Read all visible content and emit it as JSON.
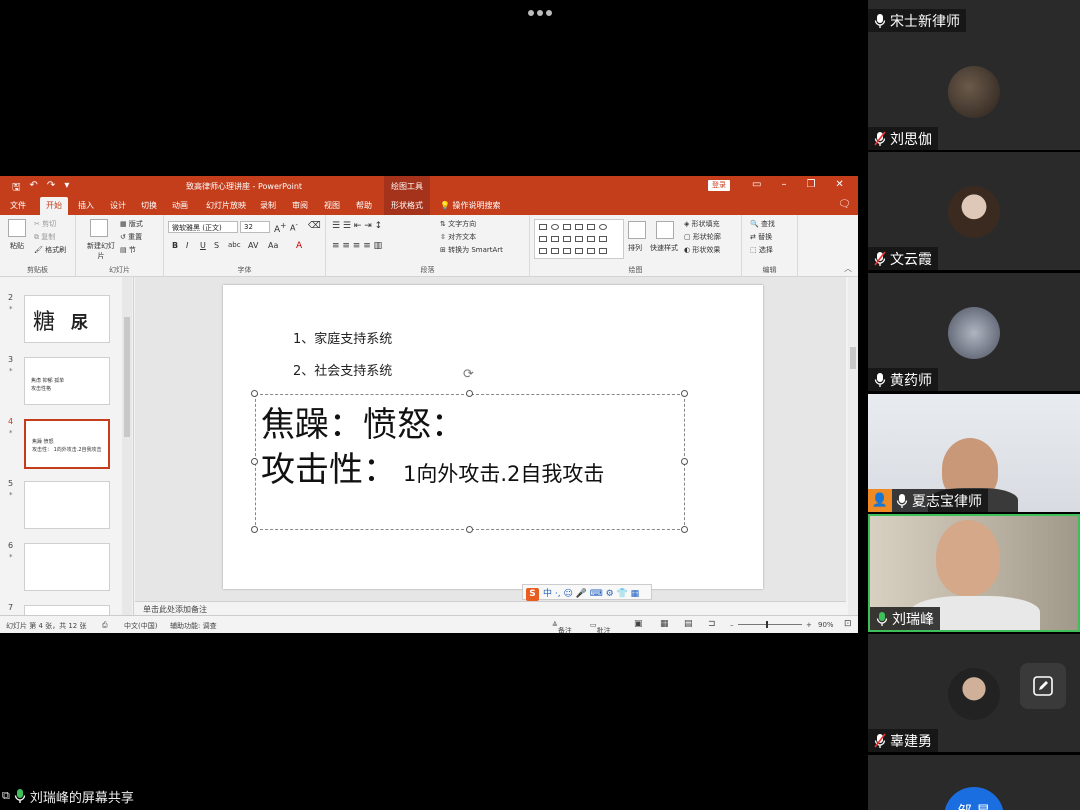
{
  "powerpoint": {
    "doc_title": "致高律师心理讲座 - PowerPoint",
    "context_tab_group": "绘图工具",
    "login_button": "登录",
    "tabs": [
      "文件",
      "开始",
      "插入",
      "设计",
      "切换",
      "动画",
      "幻灯片放映",
      "录制",
      "审阅",
      "视图",
      "帮助",
      "形状格式"
    ],
    "tell_me": "操作说明搜索",
    "ribbon": {
      "clipboard": {
        "label": "剪贴板",
        "paste": "粘贴",
        "cut": "剪切",
        "copy": "复制",
        "format_painter": "格式刷"
      },
      "slides": {
        "label": "幻灯片",
        "new_slide": "新建幻灯片",
        "layout": "版式",
        "reset": "重置",
        "section": "节"
      },
      "font": {
        "label": "字体",
        "font_name": "微软雅黑 (正文)",
        "font_size": "32"
      },
      "paragraph": {
        "label": "段落",
        "text_direction": "文字方向",
        "align_text": "对齐文本",
        "smartart": "转换为 SmartArt"
      },
      "drawing": {
        "label": "绘图",
        "arrange": "排列",
        "quick_styles": "快速样式",
        "shape_fill": "形状填充",
        "shape_outline": "形状轮廓",
        "shape_effects": "形状效果"
      },
      "editing": {
        "label": "编辑",
        "find": "查找",
        "replace": "替换",
        "select": "选择"
      }
    },
    "thumbnails": [
      {
        "num": "2",
        "char1": "糖",
        "char2": "尿"
      },
      {
        "num": "3",
        "lines": [
          "焦虑 抑郁 孤单",
          "攻击性格"
        ]
      },
      {
        "num": "4",
        "lines": [
          "焦躁 愤怒",
          "攻击性： 1向外攻击.2自我攻击"
        ]
      },
      {
        "num": "5"
      },
      {
        "num": "6"
      },
      {
        "num": "7"
      }
    ],
    "slide": {
      "line1": "1、家庭支持系统",
      "line2": "2、社会支持系统",
      "big_line1": "焦躁：愤怒：",
      "big_line2_main": "攻击性：",
      "big_line2_small": "1向外攻击.2自我攻击"
    },
    "ime_label": "中",
    "notes_placeholder": "单击此处添加备注",
    "status": {
      "slide_count": "幻灯片 第 4 张，共 12 张",
      "language": "中文(中国)",
      "accessibility": "辅助功能: 调查",
      "notes": "备注",
      "comments": "批注",
      "zoom": "90%"
    }
  },
  "screen_share_label": "刘瑞峰的屏幕共享",
  "participants": [
    {
      "name": "宋士新律师",
      "mic": "on"
    },
    {
      "name": "刘思伽",
      "mic": "muted"
    },
    {
      "name": "文云霞",
      "mic": "muted"
    },
    {
      "name": "黄药师",
      "mic": "on"
    },
    {
      "name": "夏志宝律师",
      "mic": "on",
      "host": true
    },
    {
      "name": "刘瑞峰",
      "mic": "speaking"
    },
    {
      "name": "辜建勇",
      "mic": "muted"
    }
  ],
  "bottom_avatar_text": "邹 星",
  "colors": {
    "ppt_accent": "#c43e1c",
    "speaking_border": "#3fbf5a"
  }
}
